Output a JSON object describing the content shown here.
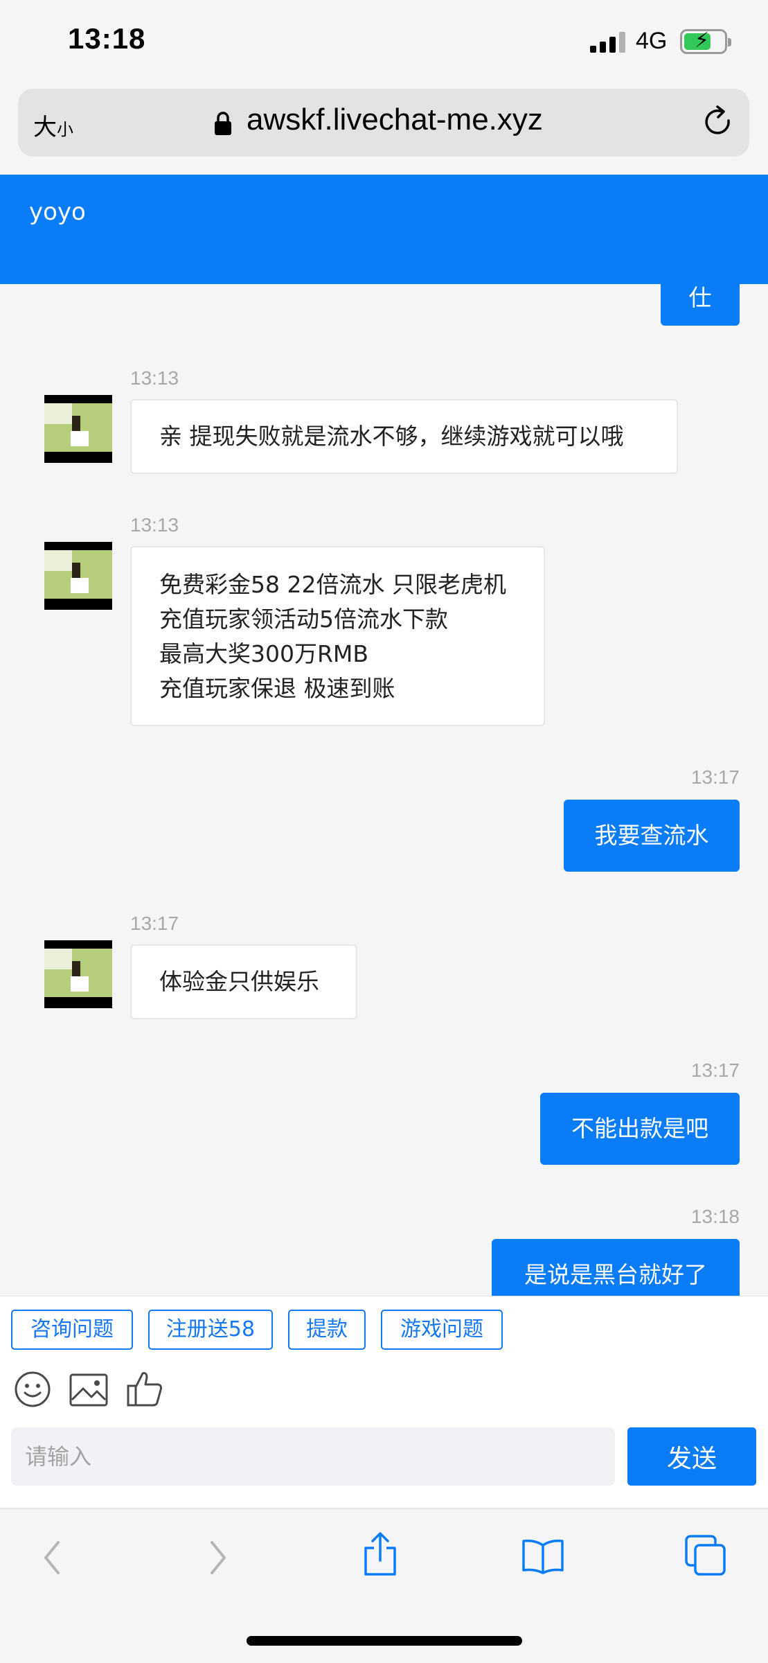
{
  "status_bar": {
    "time": "13:18",
    "network": "4G"
  },
  "browser": {
    "text_size_big": "大",
    "text_size_small": "小",
    "url": "awskf.livechat-me.xyz"
  },
  "chat": {
    "title": "yoyo",
    "partial_bubble_text": "仕",
    "messages": [
      {
        "time": "13:13",
        "lines": [
          "亲 提现失败就是流水不够，继续游戏就可以哦"
        ]
      },
      {
        "time": "13:13",
        "lines": [
          "免费彩金58 22倍流水 只限老虎机",
          "充值玩家领活动5倍流水下款",
          "最高大奖300万RMB",
          "充值玩家保退 极速到账"
        ]
      },
      {
        "time": "13:17",
        "text": "我要查流水"
      },
      {
        "time": "13:17",
        "lines": [
          "体验金只供娱乐"
        ]
      },
      {
        "time": "13:17",
        "text": "不能出款是吧"
      },
      {
        "time": "13:18",
        "text": "是说是黑台就好了"
      }
    ]
  },
  "quick_replies": [
    "咨询问题",
    "注册送58",
    "提款",
    "游戏问题"
  ],
  "composer": {
    "placeholder": "请输入",
    "send_label": "发送"
  },
  "colors": {
    "accent": "#0a7cf8",
    "battery_green": "#34c759",
    "bubble_border": "#e6e6e6"
  },
  "icons": [
    "signal-icon",
    "battery-icon",
    "lock-icon",
    "reload-icon",
    "smiley-icon",
    "image-icon",
    "thumbs-up-icon",
    "back-icon",
    "forward-icon",
    "share-icon",
    "bookmarks-icon",
    "tabs-icon"
  ]
}
